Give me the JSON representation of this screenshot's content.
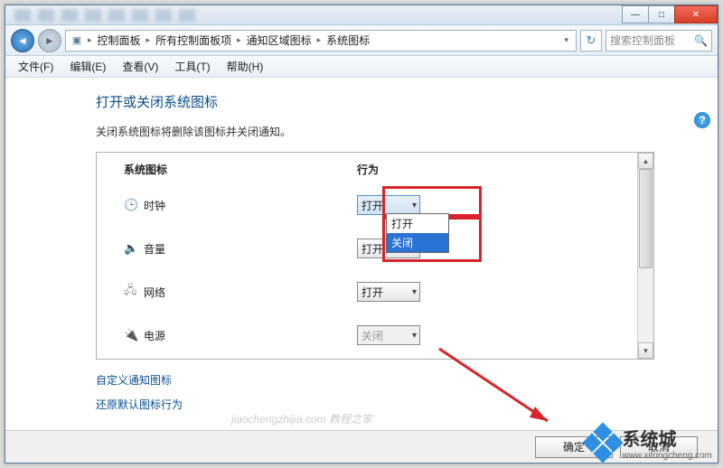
{
  "window_controls": {
    "min": "—",
    "max": "□",
    "close": "✕"
  },
  "nav": {
    "back": "◄",
    "forward": "►",
    "refresh": "↻"
  },
  "breadcrumb": {
    "icon": "▣",
    "items": [
      "控制面板",
      "所有控制面板项",
      "通知区域图标",
      "系统图标"
    ],
    "sep": "▸",
    "drop": "▾"
  },
  "search": {
    "placeholder": "搜索控制面板",
    "icon": "🔍"
  },
  "menu": {
    "file": "文件(F)",
    "edit": "编辑(E)",
    "view": "查看(V)",
    "tools": "工具(T)",
    "help": "帮助(H)"
  },
  "help_icon": "?",
  "page": {
    "title": "打开或关闭系统图标",
    "subtitle": "关闭系统图标将删除该图标并关闭通知。"
  },
  "columns": {
    "c1": "系统图标",
    "c2": "行为"
  },
  "rows": {
    "clock": {
      "icon": "🕒",
      "label": "时钟",
      "value": "打开"
    },
    "volume": {
      "icon": "🔈",
      "label": "音量",
      "value": "打开"
    },
    "network": {
      "icon": "🖧",
      "label": "网络",
      "value": "打开"
    },
    "power": {
      "icon": "🔌",
      "label": "电源",
      "value": "关闭"
    }
  },
  "dropdown": {
    "opt_open": "打开",
    "opt_close": "关闭"
  },
  "links": {
    "customize": "自定义通知图标",
    "restore": "还原默认图标行为"
  },
  "buttons": {
    "ok": "确定",
    "cancel": "取消"
  },
  "scroll": {
    "up": "▴",
    "down": "▾"
  },
  "watermark": {
    "brand": "系统城",
    "url": "www.xitongcheng.com"
  },
  "faint_watermark": "jiaochengzhijia.com 教程之家"
}
